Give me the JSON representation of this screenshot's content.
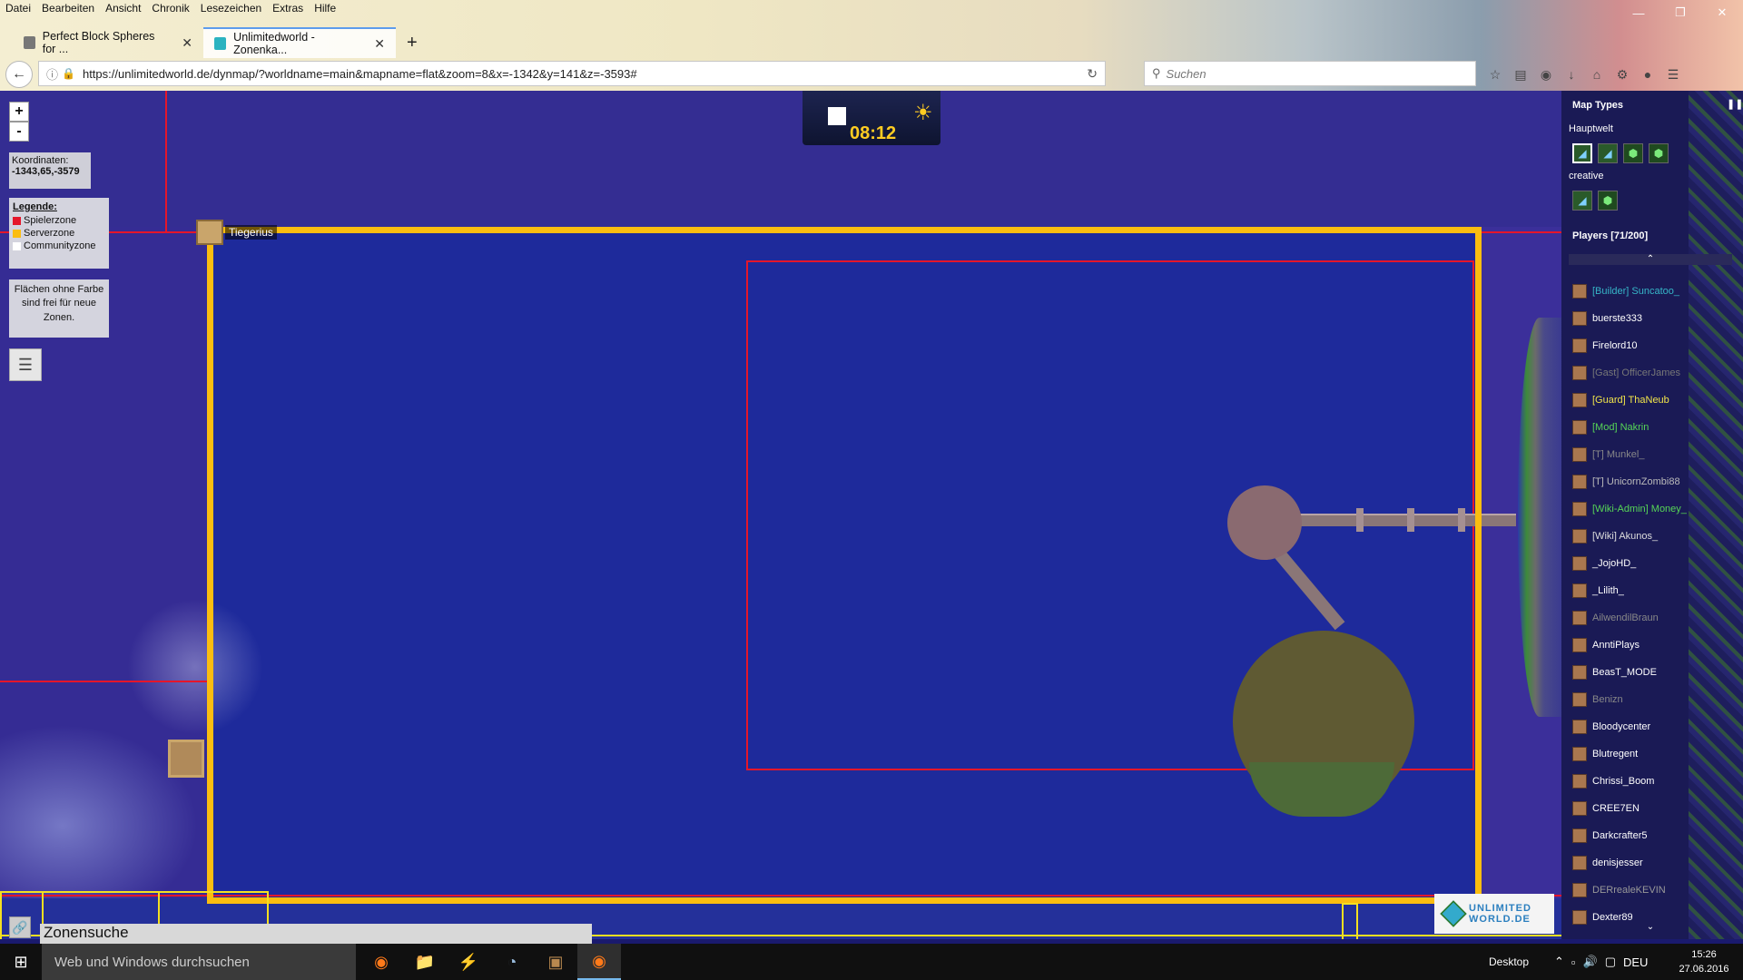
{
  "browser": {
    "menu": [
      "Datei",
      "Bearbeiten",
      "Ansicht",
      "Chronik",
      "Lesezeichen",
      "Extras",
      "Hilfe"
    ],
    "tabs": [
      {
        "title": "Perfect Block Spheres for ...",
        "favicon": "generic-icon"
      },
      {
        "title": "Unlimitedworld - Zonenka...",
        "favicon": "cube-icon"
      }
    ],
    "url": "https://unlimitedworld.de/dynmap/?worldname=main&mapname=flat&zoom=8&x=-1342&y=141&z=-3593#",
    "search_placeholder": "Suchen"
  },
  "map": {
    "zoom_in": "+",
    "zoom_out": "-",
    "coords_label": "Koordinaten:",
    "coords_value": "-1343,65,-3579",
    "legend_title": "Legende:",
    "legend": [
      {
        "label": "Spielerzone",
        "color": "#e5162a"
      },
      {
        "label": "Serverzone",
        "color": "#fbbd10"
      },
      {
        "label": "Communityzone",
        "color": "#ffffff"
      }
    ],
    "free_info": "Flächen ohne Farbe sind frei für neue Zonen.",
    "clock_time": "08:12",
    "marker_label": "Tiegerius",
    "zone_search": "Zonensuche",
    "logo_text_1": "UNLIMITED",
    "logo_text_2": "WORLD.DE"
  },
  "sidebar": {
    "title": "Map Types",
    "world1": "Hauptwelt",
    "world2": "creative",
    "players_header": "Players [71/200]",
    "players": [
      {
        "name": "[Builder] Suncatoo_",
        "color": "#36b6c8"
      },
      {
        "name": "buerste333",
        "color": "#ffffff"
      },
      {
        "name": "Firelord10",
        "color": "#ffffff"
      },
      {
        "name": "[Gast] OfficerJames",
        "color": "#777777"
      },
      {
        "name": "[Guard] ThaNeub",
        "color": "#f2e54a"
      },
      {
        "name": "[Mod] Nakrin",
        "color": "#56d656"
      },
      {
        "name": "[T] Munkel_",
        "color": "#888888"
      },
      {
        "name": "[T] UnicornZombi88",
        "color": "#bbbbbb"
      },
      {
        "name": "[Wiki-Admin] Money_",
        "color": "#56d656"
      },
      {
        "name": "[Wiki] Akunos_",
        "color": "#dddddd"
      },
      {
        "name": "_JojoHD_",
        "color": "#ffffff"
      },
      {
        "name": "_Lilith_",
        "color": "#ffffff"
      },
      {
        "name": "AilwendilBraun",
        "color": "#888888"
      },
      {
        "name": "AnntiPlays",
        "color": "#ffffff"
      },
      {
        "name": "BeasT_MODE",
        "color": "#ffffff"
      },
      {
        "name": "Benizn",
        "color": "#888888"
      },
      {
        "name": "Bloodycenter",
        "color": "#ffffff"
      },
      {
        "name": "Blutregent",
        "color": "#ffffff"
      },
      {
        "name": "Chrissi_Boom",
        "color": "#ffffff"
      },
      {
        "name": "CREE7EN",
        "color": "#ffffff"
      },
      {
        "name": "Darkcrafter5",
        "color": "#ffffff"
      },
      {
        "name": "denisjesser",
        "color": "#ffffff"
      },
      {
        "name": "DERrealeKEVIN",
        "color": "#999999"
      },
      {
        "name": "Dexter89",
        "color": "#ffffff"
      }
    ]
  },
  "taskbar": {
    "search_placeholder": "Web und Windows durchsuchen",
    "desktop_label": "Desktop",
    "lang": "DEU",
    "time": "15:26",
    "date": "27.06.2016"
  }
}
